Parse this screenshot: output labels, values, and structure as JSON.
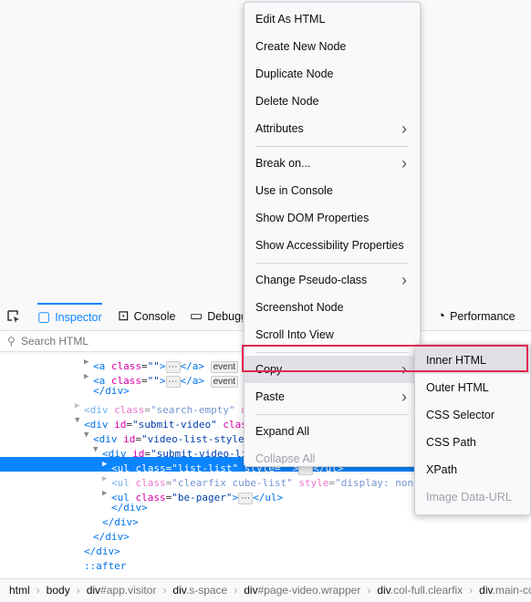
{
  "toolbar": {
    "tabs": [
      {
        "label": "Inspector",
        "icon": "inspector-icon"
      },
      {
        "label": "Console",
        "icon": "console-icon"
      },
      {
        "label": "Debugger",
        "icon": "debugger-icon"
      },
      {
        "label": "Performance",
        "icon": "performance-icon"
      }
    ]
  },
  "search": {
    "placeholder": "Search HTML"
  },
  "tree": [
    {
      "indent": 9,
      "tw": "▶",
      "html": "<a class=\"\">",
      "ell": true,
      "close": "</a>",
      "badge": "event"
    },
    {
      "indent": 9,
      "tw": "▶",
      "html": "<a class=\"\">",
      "ell": true,
      "close": "</a>",
      "badge": "event"
    },
    {
      "indent": 9,
      "tw": "",
      "html": "</div>"
    },
    {
      "indent": 8,
      "tw": "▶",
      "html": "<div class=\"search-empty\" dat",
      "dim": true
    },
    {
      "indent": 8,
      "tw": "▼",
      "html": "<div id=\"submit-video\" class="
    },
    {
      "indent": 9,
      "tw": "▼",
      "html": "<div id=\"video-list-style\""
    },
    {
      "indent": 10,
      "tw": "▼",
      "html": "<div id=\"submit-video-lis"
    },
    {
      "indent": 11,
      "tw": "▶",
      "html": "<ul class=\"list-list\" style=\"\">",
      "ell": true,
      "close": "</ul>",
      "sel": true
    },
    {
      "indent": 11,
      "tw": "▶",
      "html": "<ul class=\"clearfix cube-list\" style=\"display: none;\">",
      "dim": true
    },
    {
      "indent": 11,
      "tw": "▶",
      "html": "<ul class=\"be-pager\">",
      "ell": true,
      "close": "</ul>"
    },
    {
      "indent": 11,
      "tw": "",
      "html": "</div>"
    },
    {
      "indent": 10,
      "tw": "",
      "html": "</div>"
    },
    {
      "indent": 9,
      "tw": "",
      "html": "</div>"
    },
    {
      "indent": 8,
      "tw": "",
      "html": "</div>"
    },
    {
      "indent": 8,
      "tw": "",
      "html": "::after"
    }
  ],
  "breadcrumbs": [
    {
      "t": "html",
      "c": ""
    },
    {
      "t": "body",
      "c": ""
    },
    {
      "t": "div",
      "c": "#app.visitor"
    },
    {
      "t": "div",
      "c": ".s-space"
    },
    {
      "t": "div",
      "c": "#page-video.wrapper"
    },
    {
      "t": "div",
      "c": ".col-full.clearfix"
    },
    {
      "t": "div",
      "c": ".main-co"
    }
  ],
  "context_menu": {
    "items": [
      {
        "label": "Edit As HTML",
        "u": 0
      },
      {
        "label": "Create New Node",
        "u": 0
      },
      {
        "label": "Duplicate Node",
        "u": 0
      },
      {
        "label": "Delete Node",
        "u": 0
      },
      {
        "label": "Attributes",
        "u": 0,
        "sub": true
      },
      {
        "sep": true
      },
      {
        "label": "Break on...",
        "u": 0,
        "sub": true
      },
      {
        "label": "Use in Console"
      },
      {
        "label": "Show DOM Properties"
      },
      {
        "label": "Show Accessibility Properties"
      },
      {
        "sep": true
      },
      {
        "label": "Change Pseudo-class",
        "sub": true
      },
      {
        "label": "Screenshot Node"
      },
      {
        "label": "Scroll Into View",
        "u": 0
      },
      {
        "sep": true
      },
      {
        "label": "Copy",
        "sub": true,
        "hl": true
      },
      {
        "label": "Paste",
        "sub": true
      },
      {
        "sep": true
      },
      {
        "label": "Expand All"
      },
      {
        "label": "Collapse All",
        "dis": true
      }
    ]
  },
  "copy_submenu": {
    "items": [
      {
        "label": "Inner HTML",
        "u": 0,
        "hl": true
      },
      {
        "label": "Outer HTML",
        "u": 0
      },
      {
        "label": "CSS Selector",
        "u": 1
      },
      {
        "label": "CSS Path",
        "u": 4
      },
      {
        "label": "XPath",
        "u": 0
      },
      {
        "label": "Image Data-URL",
        "dis": true
      }
    ]
  },
  "colors": {
    "accent": "#0a84ff",
    "highlight_box": "#e22850"
  }
}
